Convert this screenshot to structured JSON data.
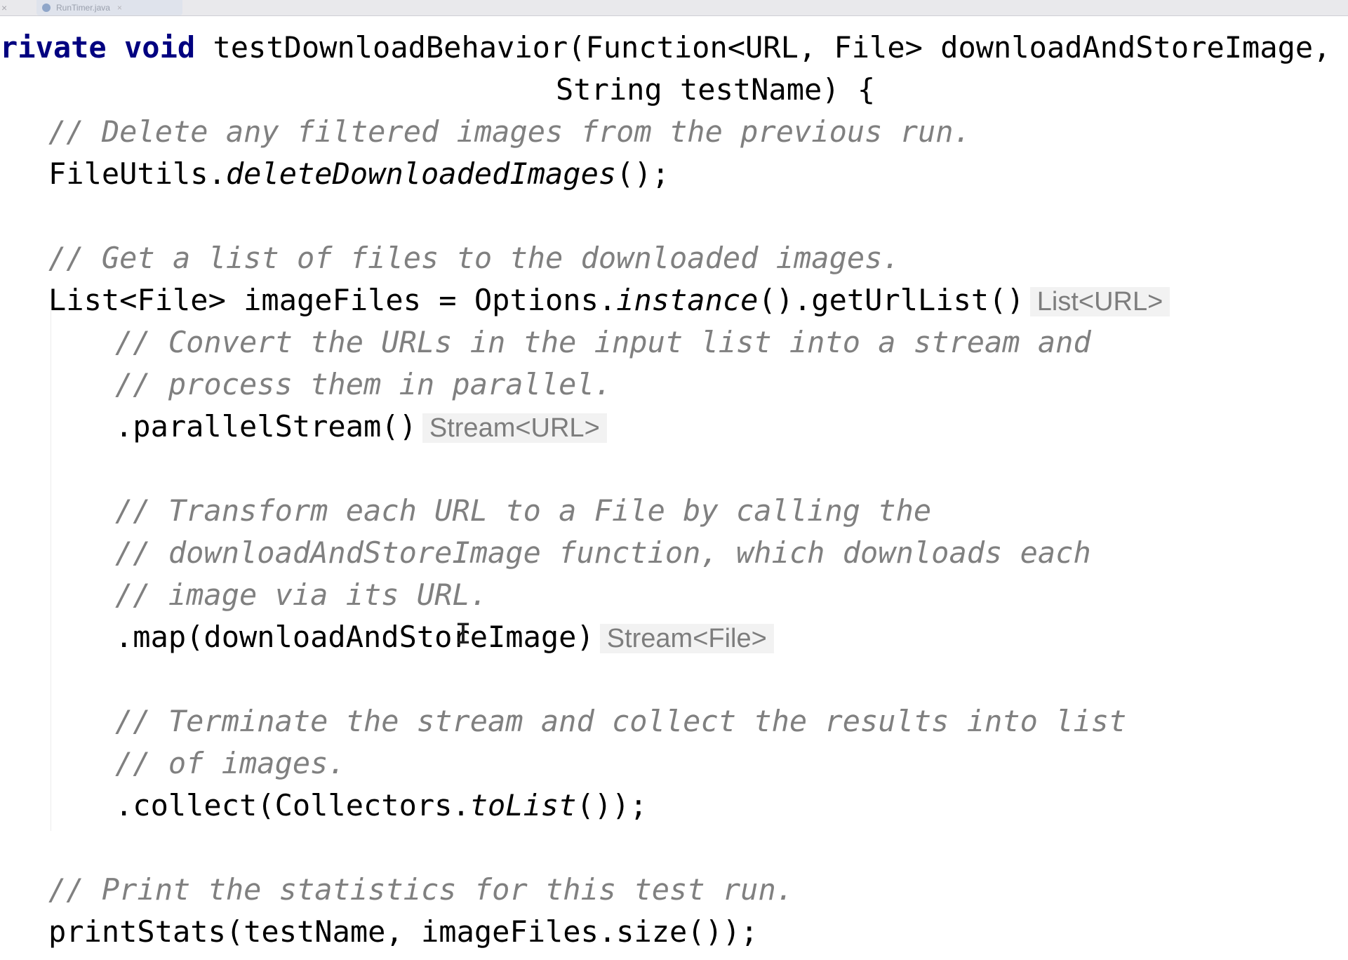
{
  "tabs": [
    {
      "name": "close-tab",
      "label": "×"
    },
    {
      "name": "runtimer-tab",
      "label": "RunTimer.java"
    }
  ],
  "code": {
    "l1_kw1": "rivate",
    "l1_kw2": "void",
    "l1_rest": " testDownloadBehavior(Function<URL, File> downloadAndStoreImage,",
    "l2": "String testName) {",
    "l3": "// Delete any filtered images from the previous run.",
    "l4_obj": "FileUtils.",
    "l4_call": "deleteDownloadedImages",
    "l4_end": "();",
    "l6": "// Get a list of files to the downloaded images.",
    "l7_pre": "List<File> imageFiles = Options.",
    "l7_call": "instance",
    "l7_post": "().getUrlList()",
    "l7_hint": "List<URL>",
    "l8": "// Convert the URLs in the input list into a stream and",
    "l9": "// process them in parallel.",
    "l10": ".parallelStream()",
    "l10_hint": "Stream<URL>",
    "l12": "// Transform each URL to a File by calling the",
    "l13": "// downloadAndStoreImage function, which downloads each",
    "l14": "// image via its URL.",
    "l15": ".map(downloadAndStoreImage)",
    "l15_hint": "Stream<File>",
    "l17": "// Terminate the stream and collect the results into list",
    "l18": "// of images.",
    "l19_pre": ".collect(Collectors.",
    "l19_call": "toList",
    "l19_end": "());",
    "l21": "// Print the statistics for this test run.",
    "l22": "printStats(testName, imageFiles.size());"
  },
  "cursor_glyph": "I"
}
